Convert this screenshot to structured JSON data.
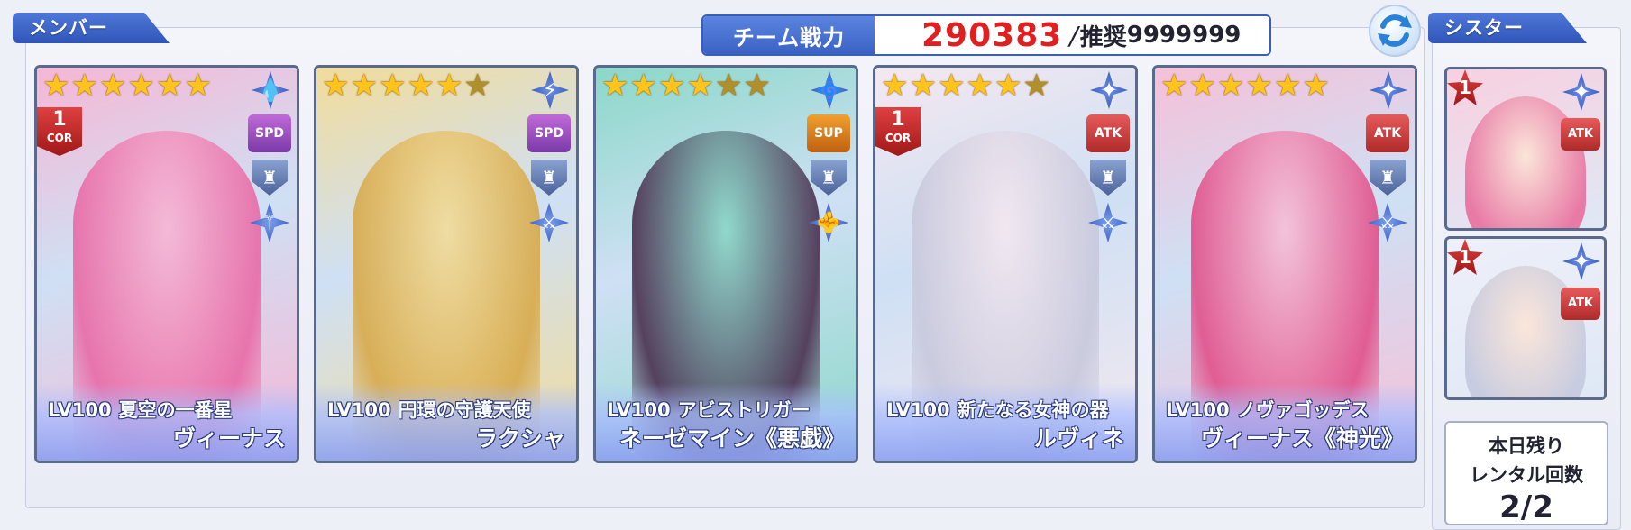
{
  "header": {
    "member_tab": "メンバー",
    "sister_tab": "シスター",
    "team_power_label": "チーム戦力",
    "team_power_value": "290383",
    "recommended_label": "推奨",
    "recommended_value": "9999999",
    "refresh_icon": "refresh-icon"
  },
  "members": [
    {
      "stars": 6,
      "element_icon": "water-icon",
      "cor": "1",
      "cor_label": "COR",
      "role": "SPD",
      "role_icon": "speed-boot-icon",
      "class_icon": "shield-icon",
      "weapon_icon": "staff-icon",
      "level": "LV100",
      "title": "夏空の一番星",
      "name": "ヴィーナス",
      "colors": [
        "#f7b6d4",
        "#e86aa6"
      ]
    },
    {
      "stars": 5,
      "element_icon": "lightning-icon",
      "role": "SPD",
      "role_icon": "speed-boot-icon",
      "class_icon": "shield-icon",
      "weapon_icon": "sword-icon",
      "level": "LV100",
      "title": "円環の守護天使",
      "name": "ラクシャ",
      "colors": [
        "#f2dc9a",
        "#d7a94a"
      ]
    },
    {
      "stars": 4,
      "element_icon": "wind-icon",
      "role": "SUP",
      "role_icon": "support-icon",
      "class_icon": "shield-icon",
      "weapon_icon": "fist-icon",
      "level": "LV100",
      "title": "アビストリガー",
      "name": "ネーゼマイン《悪戯》",
      "colors": [
        "#8ad8c8",
        "#4a3050"
      ]
    },
    {
      "stars": 5,
      "element_icon": "light-icon",
      "cor": "1",
      "cor_label": "COR",
      "role": "ATK",
      "role_icon": "attack-icon",
      "class_icon": "shield-icon",
      "weapon_icon": "sword-icon",
      "level": "LV100",
      "title": "新たなる女神の器",
      "name": "ルヴィネ",
      "colors": [
        "#f4e8f0",
        "#c8c8dc"
      ]
    },
    {
      "stars": 6,
      "element_icon": "light-icon",
      "role": "ATK",
      "role_icon": "attack-icon",
      "class_icon": "shield-icon",
      "weapon_icon": "sword-icon",
      "level": "LV100",
      "title": "ノヴァゴッデス",
      "name": "ヴィーナス《神光》",
      "colors": [
        "#f6c0d8",
        "#e0508a"
      ]
    }
  ],
  "sisters": [
    {
      "rank": "1",
      "element_icon": "light-icon",
      "role": "ATK",
      "colors": [
        "#f8d0e0",
        "#e87aa6"
      ]
    },
    {
      "rank": "1",
      "element_icon": "light-icon",
      "role": "ATK",
      "colors": [
        "#eef0f8",
        "#c8cce0"
      ]
    }
  ],
  "rental": {
    "line1": "本日残り",
    "line2": "レンタル回数",
    "value": "2/2"
  },
  "colors": {
    "accent": "#3a5fb8",
    "power_red": "#e02020",
    "star_gold": "#ffc41c"
  }
}
